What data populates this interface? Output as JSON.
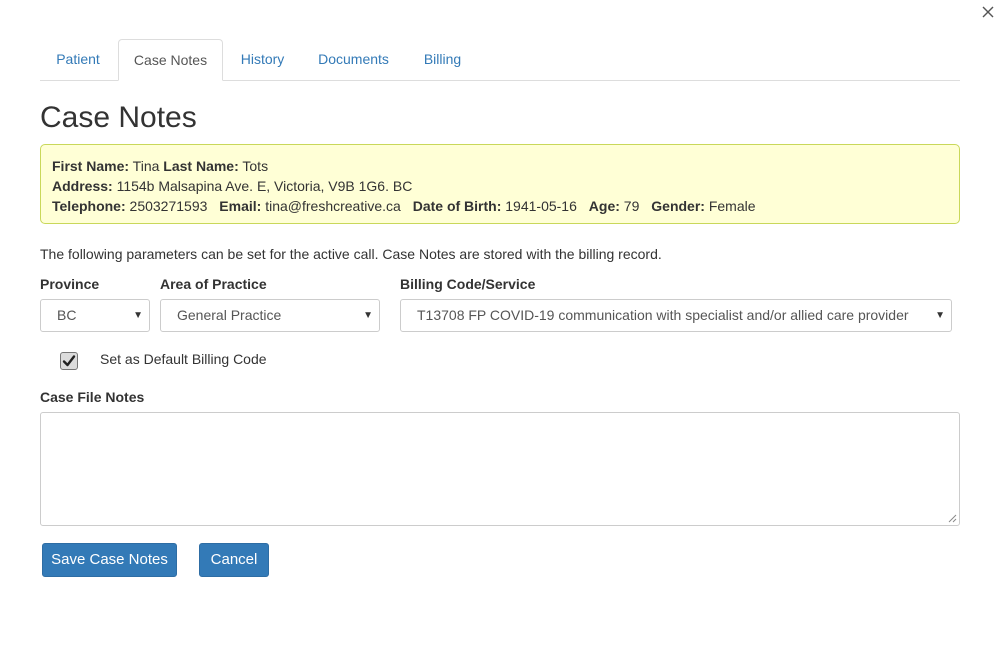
{
  "tabs": [
    {
      "label": "Patient",
      "active": false
    },
    {
      "label": "Case Notes",
      "active": true
    },
    {
      "label": "History",
      "active": false
    },
    {
      "label": "Documents",
      "active": false
    },
    {
      "label": "Billing",
      "active": false
    }
  ],
  "page_title": "Case Notes",
  "patient": {
    "first_name_label": "First Name:",
    "first_name": "Tina",
    "last_name_label": "Last Name:",
    "last_name": "Tots",
    "address_label": "Address:",
    "address": "1154b Malsapina Ave. E, Victoria, V9B 1G6. BC",
    "telephone_label": "Telephone:",
    "telephone": "2503271593",
    "email_label": "Email:",
    "email": "tina@freshcreative.ca",
    "dob_label": "Date of Birth:",
    "dob": "1941-05-16",
    "age_label": "Age:",
    "age": "79",
    "gender_label": "Gender:",
    "gender": "Female"
  },
  "help_text": "The following parameters can be set for the active call. Case Notes are stored with the billing record.",
  "form": {
    "province_label": "Province",
    "province_value": "BC",
    "area_label": "Area of Practice",
    "area_value": "General Practice",
    "billing_label": "Billing Code/Service",
    "billing_value": "T13708 FP COVID-19 communication with specialist and/or allied care provider",
    "default_billing_label": "Set as Default Billing Code",
    "default_billing_checked": true,
    "notes_label": "Case File Notes",
    "notes_value": ""
  },
  "buttons": {
    "save_label": "Save Case Notes",
    "cancel_label": "Cancel"
  },
  "colors": {
    "link": "#337ab7",
    "primary_button": "#337ab7",
    "info_background": "#ffffd6",
    "info_border": "#c9d85a"
  },
  "icons": {
    "close": "close-icon",
    "dropdown": "chevron-down-icon",
    "checkbox": "checkmark-icon",
    "resize": "resize-grip-icon"
  }
}
